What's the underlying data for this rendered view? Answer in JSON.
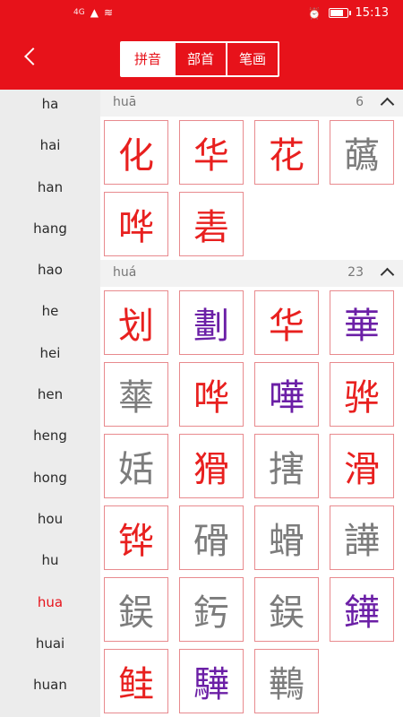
{
  "status_bar": {
    "signal": "4G",
    "time": "15:13"
  },
  "tabs": [
    {
      "label": "拼音",
      "active": true
    },
    {
      "label": "部首",
      "active": false
    },
    {
      "label": "笔画",
      "active": false
    }
  ],
  "pinyin_list": [
    "ha",
    "hai",
    "han",
    "hang",
    "hao",
    "he",
    "hei",
    "hen",
    "heng",
    "hong",
    "hou",
    "hu",
    "hua",
    "huai",
    "huan"
  ],
  "active_pinyin": "hua",
  "sections": [
    {
      "pinyin": "huā",
      "count": "6",
      "chars": [
        {
          "c": "化",
          "color": "red"
        },
        {
          "c": "华",
          "color": "red"
        },
        {
          "c": "花",
          "color": "red"
        },
        {
          "c": "蘤",
          "color": "gray"
        },
        {
          "c": "哗",
          "color": "red"
        },
        {
          "c": "砉",
          "color": "red"
        }
      ]
    },
    {
      "pinyin": "huá",
      "count": "23",
      "chars": [
        {
          "c": "划",
          "color": "red"
        },
        {
          "c": "劃",
          "color": "purple"
        },
        {
          "c": "华",
          "color": "red"
        },
        {
          "c": "華",
          "color": "purple"
        },
        {
          "c": "蕐",
          "color": "gray"
        },
        {
          "c": "哗",
          "color": "red"
        },
        {
          "c": "嘩",
          "color": "purple"
        },
        {
          "c": "骅",
          "color": "red"
        },
        {
          "c": "姡",
          "color": "gray"
        },
        {
          "c": "猾",
          "color": "red"
        },
        {
          "c": "搳",
          "color": "gray"
        },
        {
          "c": "滑",
          "color": "red"
        },
        {
          "c": "铧",
          "color": "red"
        },
        {
          "c": "磆",
          "color": "gray"
        },
        {
          "c": "螖",
          "color": "gray"
        },
        {
          "c": "譁",
          "color": "gray"
        },
        {
          "c": "鋘",
          "color": "gray"
        },
        {
          "c": "釫",
          "color": "gray"
        },
        {
          "c": "鋘",
          "color": "gray"
        },
        {
          "c": "鏵",
          "color": "purple"
        },
        {
          "c": "鲑",
          "color": "red"
        },
        {
          "c": "驊",
          "color": "purple"
        },
        {
          "c": "鷨",
          "color": "gray"
        }
      ]
    }
  ]
}
